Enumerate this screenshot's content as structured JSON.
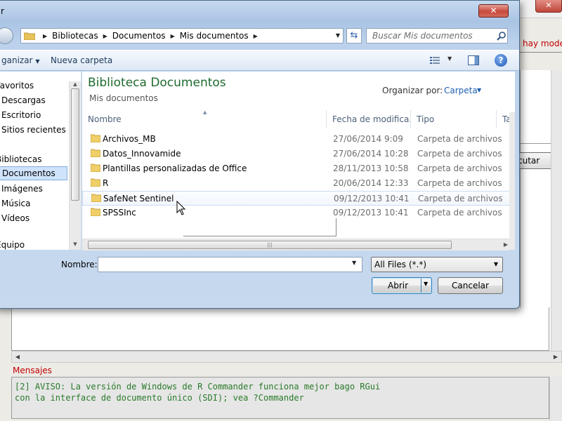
{
  "background": {
    "red_hint": "hay model",
    "run_button_label": "cutar",
    "messages_label": "Mensajes",
    "messages_lines": [
      "[2] AVISO: La versión de Windows de R Commander funciona mejor bago RGui",
      "con la interface de documento único (SDI); vea ?Commander"
    ]
  },
  "dialog": {
    "title": "r",
    "address": [
      "Bibliotecas",
      "Documentos",
      "Mis documentos"
    ],
    "search_placeholder": "Buscar Mis documentos",
    "toolbar": {
      "organize": "ganizar",
      "new_folder": "Nueva carpeta"
    },
    "nav": {
      "items": [
        {
          "label": "Favoritos",
          "icon": "star-icon"
        },
        {
          "label": "Descargas",
          "icon": "downloads-folder-icon"
        },
        {
          "label": "Escritorio",
          "icon": "desktop-icon"
        },
        {
          "label": "Sitios recientes",
          "icon": "recent-places-icon"
        },
        {
          "label": "Bibliotecas",
          "icon": "libraries-icon"
        },
        {
          "label": "Documentos",
          "icon": "documents-icon"
        },
        {
          "label": "Imágenes",
          "icon": "pictures-icon"
        },
        {
          "label": "Música",
          "icon": "music-icon"
        },
        {
          "label": "Vídeos",
          "icon": "videos-icon"
        },
        {
          "label": "Equipo",
          "icon": "computer-icon"
        }
      ],
      "selected": "Documentos"
    },
    "content": {
      "library_title": "Biblioteca Documentos",
      "library_subtitle": "Mis documentos",
      "arrange_label": "Organizar por:",
      "arrange_value": "Carpeta",
      "columns": [
        "Nombre",
        "Fecha de modifica...",
        "Tipo",
        "Ta"
      ],
      "rows": [
        {
          "name": "Archivos_MB",
          "date": "27/06/2014 9:09",
          "type": "Carpeta de archivos"
        },
        {
          "name": "Datos_Innovamide",
          "date": "27/06/2014 10:28",
          "type": "Carpeta de archivos"
        },
        {
          "name": "Plantillas personalizadas de Office",
          "date": "28/11/2013 10:58",
          "type": "Carpeta de archivos"
        },
        {
          "name": "R",
          "date": "20/06/2014 12:33",
          "type": "Carpeta de archivos"
        },
        {
          "name": "SafeNet Sentinel",
          "date": "09/12/2013 10:41",
          "type": "Carpeta de archivos"
        },
        {
          "name": "SPSSInc",
          "date": "09/12/2013 10:41",
          "type": "Carpeta de archivos"
        }
      ],
      "hovered_row": "SafeNet Sentinel"
    },
    "filename_label": "Nombre:",
    "filename_value": "",
    "filetype_value": "All Files (*.*)",
    "open_button": "Abrir",
    "cancel_button": "Cancelar"
  }
}
